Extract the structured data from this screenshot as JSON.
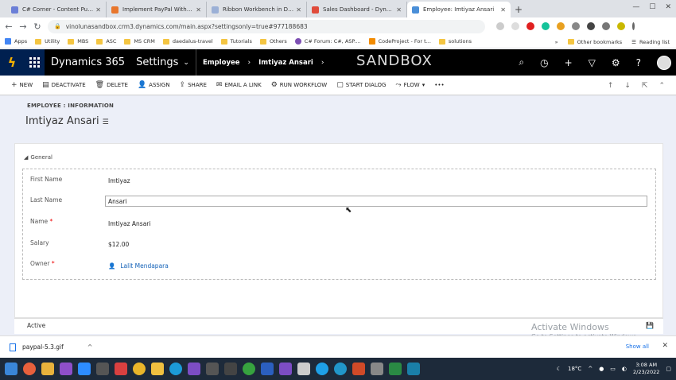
{
  "browser": {
    "tabs": [
      {
        "title": "C# Corner - Content Publish",
        "color": "#6b7fd7"
      },
      {
        "title": "Implement PayPal With Rec",
        "color": "#e8762d"
      },
      {
        "title": "Ribbon Workbench in Dyna",
        "color": "#9bb0d6"
      },
      {
        "title": "Sales Dashboard - Dynamic",
        "color": "#e04b3b"
      },
      {
        "title": "Employee: Imtiyaz Ansari",
        "color": "#4a8fd8"
      }
    ],
    "url": "vinolunasandbox.crm3.dynamics.com/main.aspx?settingsonly=true#977188683",
    "bookmarks": [
      "Apps",
      "Utility",
      "MBS",
      "ASC",
      "MS CRM",
      "daedalus-travel",
      "Tutorials",
      "Others",
      "C# Forum: C#, ASP....",
      "CodeProject - For t...",
      "solutions"
    ],
    "bookmarks_right": [
      "Other bookmarks",
      "Reading list"
    ]
  },
  "crm": {
    "app_name": "Dynamics 365",
    "area": "Settings",
    "breadcrumb": [
      "Employee",
      "Imtiyaz Ansari"
    ],
    "environment": "SANDBOX",
    "commands": [
      "NEW",
      "DEACTIVATE",
      "DELETE",
      "ASSIGN",
      "SHARE",
      "EMAIL A LINK",
      "RUN WORKFLOW",
      "START DIALOG",
      "FLOW"
    ],
    "more": "•••"
  },
  "form": {
    "entity_label": "EMPLOYEE : INFORMATION",
    "record_name": "Imtiyaz Ansari",
    "section_title": "General",
    "fields": {
      "first_name_label": "First Name",
      "first_name": "Imtiyaz",
      "last_name_label": "Last Name",
      "last_name": "Ansari",
      "name_label": "Name",
      "name": "Imtiyaz Ansari",
      "salary_label": "Salary",
      "salary": "$12.00",
      "owner_label": "Owner",
      "owner": "Lalit Mendapara"
    },
    "status": "Active"
  },
  "watermark": {
    "line1": "Activate Windows",
    "line2": "Go to Settings to activate Windows."
  },
  "download": {
    "file": "paypal-5.3.gif",
    "show_all": "Show all"
  },
  "taskbar": {
    "weather": "18°C",
    "time": "3:08 AM",
    "date": "2/23/2022"
  }
}
